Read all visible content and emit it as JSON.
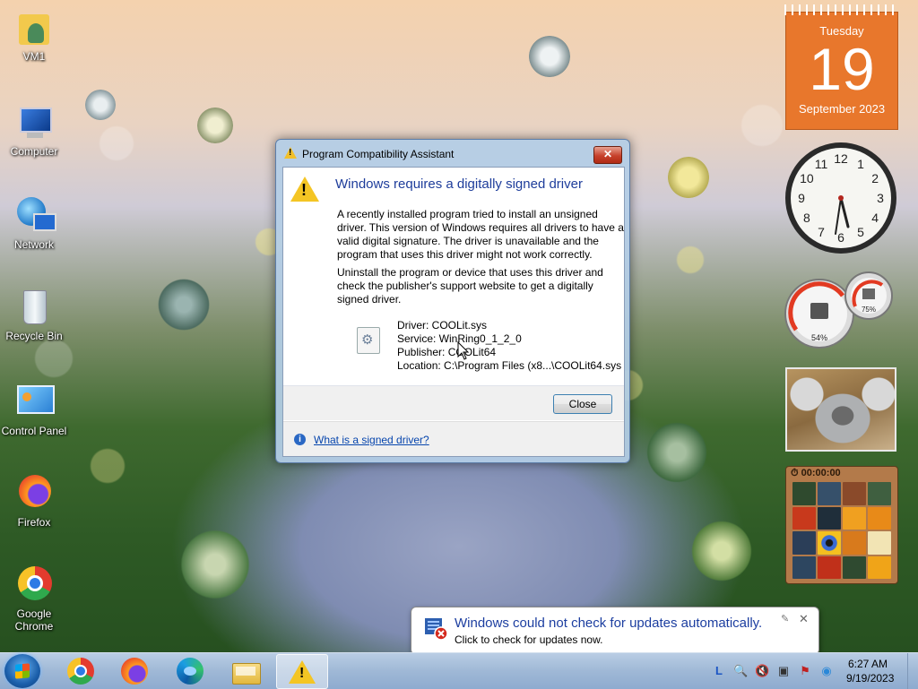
{
  "desktop": {
    "icons": [
      {
        "label": "VM1",
        "icon": "user-folder-icon"
      },
      {
        "label": "Computer",
        "icon": "computer-icon"
      },
      {
        "label": "Network",
        "icon": "network-icon"
      },
      {
        "label": "Recycle Bin",
        "icon": "recycle-bin-icon"
      },
      {
        "label": "Control Panel",
        "icon": "control-panel-icon"
      },
      {
        "label": "Firefox",
        "icon": "firefox-icon"
      },
      {
        "label": "Google Chrome",
        "icon": "chrome-icon"
      }
    ]
  },
  "dialog": {
    "window_title": "Program Compatibility Assistant",
    "heading": "Windows requires a digitally signed driver",
    "paragraph1": "A recently installed program tried to install an unsigned driver. This version of Windows requires all drivers to have a valid digital signature. The driver is unavailable and the program that uses this driver might not work correctly.",
    "paragraph2": "Uninstall the program or device that uses this driver and check the publisher's support website to get a digitally signed driver.",
    "driver": "Driver: COOLit.sys",
    "service": "Service: WinRing0_1_2_0",
    "publisher": "Publisher: COOLit64",
    "location": "Location: C:\\Program Files (x8...\\COOLit64.sys",
    "close_button": "Close",
    "help_link": "What is a signed driver?"
  },
  "gadgets": {
    "calendar": {
      "day_of_week": "Tuesday",
      "day": "19",
      "month_year": "September 2023"
    },
    "clock": {
      "numbers": [
        "12",
        "1",
        "2",
        "3",
        "4",
        "5",
        "6",
        "7",
        "8",
        "9",
        "10",
        "11"
      ]
    },
    "meter": {
      "cpu": "54%",
      "memory": "75%"
    },
    "puzzle": {
      "timer": "00:00:00"
    }
  },
  "notification": {
    "title": "Windows could not check for updates automatically.",
    "text": "Click to check for updates now."
  },
  "taskbar": {
    "apps": [
      {
        "name": "Google Chrome",
        "icon": "chrome-icon"
      },
      {
        "name": "Firefox",
        "icon": "firefox-icon"
      },
      {
        "name": "Microsoft Edge",
        "icon": "edge-icon"
      },
      {
        "name": "Windows Explorer",
        "icon": "folder-icon"
      },
      {
        "name": "Program Compatibility Assistant",
        "icon": "warning-icon"
      }
    ],
    "time": "6:27 AM",
    "date": "9/19/2023"
  },
  "colors": {
    "heading_blue": "#1e3d9b",
    "link_blue": "#0645ad",
    "calendar_orange": "#e8772c",
    "warning_yellow": "#f4c524"
  }
}
